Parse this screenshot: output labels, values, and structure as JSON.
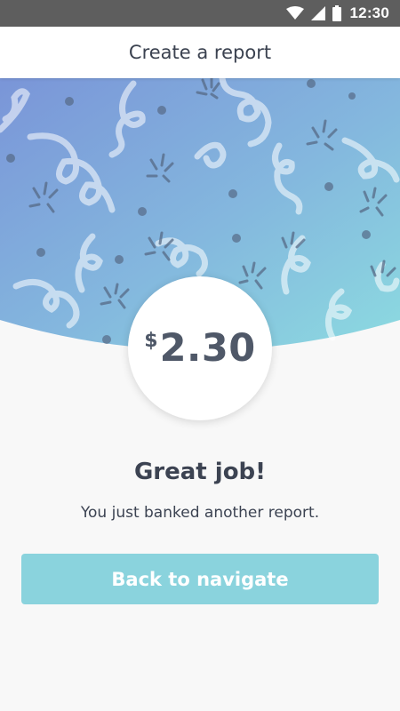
{
  "status_bar": {
    "time": "12:30",
    "background": "#5e5e5e"
  },
  "app_bar": {
    "title": "Create a report"
  },
  "hero": {
    "gradient_start": "#7a9ad9",
    "gradient_end": "#88d7e0"
  },
  "reward": {
    "currency": "$",
    "amount": "2.30"
  },
  "message": {
    "headline": "Great job!",
    "subtext": "You just banked another report."
  },
  "actions": {
    "back_label": "Back to navigate",
    "button_color": "#8ad3dd"
  }
}
